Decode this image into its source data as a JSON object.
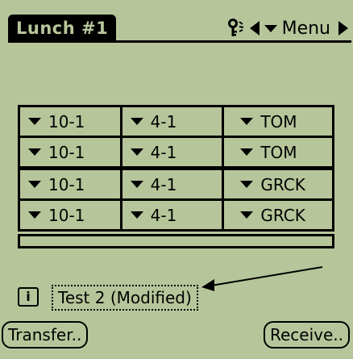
{
  "header": {
    "title": "Lunch #1",
    "menu_label": "Menu"
  },
  "grid": {
    "rows": [
      [
        "10-1",
        "4-1",
        "TOM"
      ],
      [
        "10-1",
        "4-1",
        "TOM"
      ],
      [
        "10-1",
        "4-1",
        "GRCK"
      ],
      [
        "10-1",
        "4-1",
        "GRCK"
      ]
    ]
  },
  "footer": {
    "info_icon_glyph": "i",
    "record_name": "Test 2 (Modified)",
    "transfer_label": "Transfer..",
    "receive_label": "Receive.."
  },
  "colors": {
    "screen_background": "#b7c69a",
    "ink": "#000000"
  }
}
